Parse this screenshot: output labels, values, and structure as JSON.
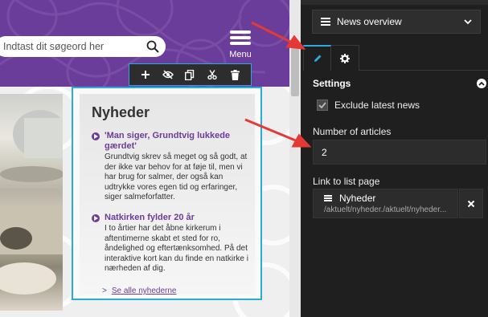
{
  "website": {
    "search_placeholder": "Indtast dit søgeord her",
    "menu_label": "Menu",
    "accent_color": "#6a3d9a"
  },
  "component_toolbar": {
    "buttons": [
      "add-icon",
      "hide-icon",
      "copy-icon",
      "cut-icon",
      "delete-icon"
    ]
  },
  "news": {
    "title": "Nyheder",
    "items": [
      {
        "headline": "'Man siger, Grundtvig lukkede gærdet'",
        "text": "Grundtvig skrev så meget og så godt, at der ikke var behov for at føje til, men vi har brug for salmer, der også kan udtrykke vores egen tid og erfaringer, siger salmeforfatter."
      },
      {
        "headline": "Natkirken fylder 20 år",
        "text": "I to årtier har det åbne kirkerum i aftentimerne skabt et sted for ro, åndelighed og eftertænksomhed. På det interaktive kort kan du finde en natkirke i nærheden af dig."
      }
    ],
    "see_all": "Se alle nyhederne"
  },
  "panel": {
    "component_type": "News overview",
    "tabs": [
      "edit",
      "settings"
    ],
    "settings_title": "Settings",
    "exclude_latest_label": "Exclude latest news",
    "exclude_latest_checked": true,
    "articles_label": "Number of articles",
    "articles_value": "2",
    "link_label": "Link to list page",
    "link_name": "Nyheder",
    "link_path": "/aktuelt/nyheder./aktuelt/nyheder...",
    "highlight_color": "#2eaadc",
    "arrow_color": "#e53935"
  }
}
